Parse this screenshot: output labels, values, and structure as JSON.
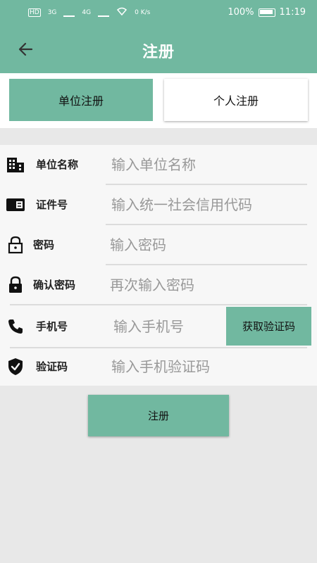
{
  "status_bar": {
    "network_badge": "HD",
    "signal_1": "3G",
    "signal_2": "4G",
    "speed": "0 K/s",
    "battery": "100%",
    "time": "11:19"
  },
  "app_bar": {
    "title": "注册",
    "back_icon": "arrow-left-icon"
  },
  "tabs": [
    {
      "label": "单位注册",
      "active": true
    },
    {
      "label": "个人注册",
      "active": false
    }
  ],
  "form": {
    "org_name": {
      "label": "单位名称",
      "placeholder": "输入单位名称",
      "icon": "building-icon"
    },
    "id_number": {
      "label": "证件号",
      "placeholder": "输入统一社会信用代码",
      "icon": "id-card-icon"
    },
    "password": {
      "label": "密码",
      "placeholder": "输入密码",
      "icon": "lock-outline-icon"
    },
    "confirm_password": {
      "label": "确认密码",
      "placeholder": "再次输入密码",
      "icon": "lock-filled-icon"
    },
    "phone": {
      "label": "手机号",
      "placeholder": "输入手机号",
      "icon": "phone-icon"
    },
    "get_code_label": "获取验证码",
    "verify_code": {
      "label": "验证码",
      "placeholder": "输入手机验证码",
      "icon": "shield-check-icon"
    }
  },
  "submit_label": "注册",
  "colors": {
    "accent": "#71b8a0",
    "background": "#e8e8e8",
    "form_bg": "#f7f7f7"
  }
}
